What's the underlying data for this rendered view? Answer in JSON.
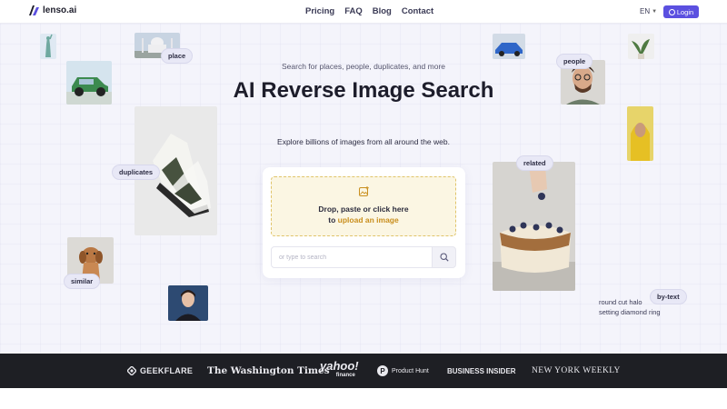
{
  "header": {
    "brand": "lenso.ai",
    "nav": [
      "Pricing",
      "FAQ",
      "Blog",
      "Contact"
    ],
    "language": "EN",
    "login_label": "Login"
  },
  "hero": {
    "eyebrow": "Search for places, people, duplicates, and more",
    "title": "AI Reverse Image Search",
    "subtitle": "Explore billions of images from all around the web."
  },
  "upload": {
    "line1": "Drop, paste or click here",
    "line2_prefix": "to ",
    "line2_link": "upload an image",
    "search_placeholder": "or type to search"
  },
  "tags": {
    "place": "place",
    "people": "people",
    "duplicates": "duplicates",
    "related": "related",
    "similar": "similar",
    "bytext": "by-text"
  },
  "bytext_example": {
    "line1": "round cut halo",
    "line2": "setting diamond ring"
  },
  "press": {
    "geekflare": "GEEKFLARE",
    "washington_times": "The Washington Times",
    "yahoo": "yahoo!",
    "yahoo_sub": "finance",
    "product_hunt": "Product Hunt",
    "business_insider": "BUSINESS INSIDER",
    "new_york_weekly": "NEW YORK WEEKLY"
  },
  "colors": {
    "accent": "#5b50e0",
    "upload_link": "#c98f1e",
    "dropzone_bg": "#fbf6e3",
    "press_bar": "#1e1f24"
  }
}
